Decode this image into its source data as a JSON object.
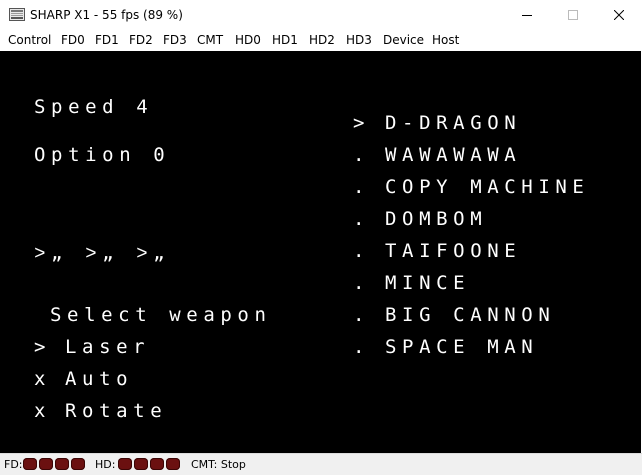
{
  "window": {
    "title": "SHARP X1 - 55 fps (89 %)",
    "icon": "floppy-disk-icon"
  },
  "menubar": {
    "items": [
      "Control",
      "FD0",
      "FD1",
      "FD2",
      "FD3",
      "CMT",
      "HD0",
      "HD1",
      "HD2",
      "HD3",
      "Device",
      "Host"
    ]
  },
  "screen": {
    "speed": "Speed 4",
    "option": "Option 0",
    "ships": "˃„ ˃„ ˃„",
    "select_label": "Select weapon",
    "weapons": [
      {
        "marker": ">",
        "name": "Laser"
      },
      {
        "marker": "x",
        "name": "Auto"
      },
      {
        "marker": "x",
        "name": "Rotate"
      }
    ],
    "enemies": [
      {
        "marker": ">",
        "name": "D-DRAGON"
      },
      {
        "marker": ".",
        "name": "WAWAWAWA"
      },
      {
        "marker": ".",
        "name": "COPY MACHINE"
      },
      {
        "marker": ".",
        "name": "DOMBOM"
      },
      {
        "marker": ".",
        "name": "TAIFOONE"
      },
      {
        "marker": ".",
        "name": "MINCE"
      },
      {
        "marker": ".",
        "name": "BIG CANNON"
      },
      {
        "marker": ".",
        "name": "SPACE MAN"
      }
    ]
  },
  "statusbar": {
    "fd_label": "FD:",
    "hd_label": "HD:",
    "cmt_status": "CMT: Stop",
    "led_color": "#6b1010"
  }
}
